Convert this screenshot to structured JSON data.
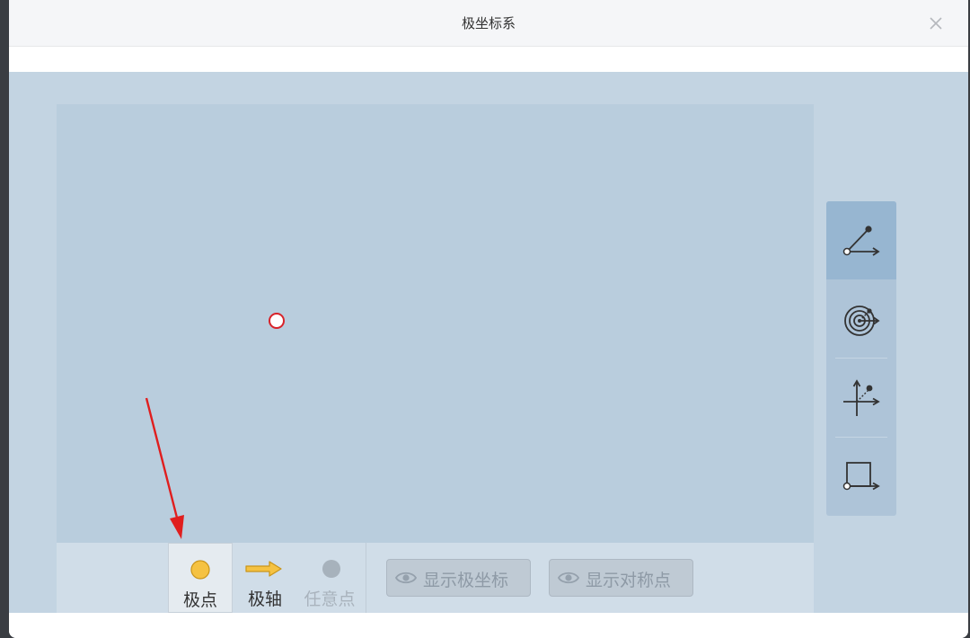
{
  "dialog": {
    "title": "极坐标系",
    "close_icon": "close-icon"
  },
  "toolbar": {
    "tools": [
      {
        "label": "极点",
        "icon": "circle-yellow-icon",
        "active": true,
        "enabled": true
      },
      {
        "label": "极轴",
        "icon": "arrow-right-yellow-icon",
        "active": false,
        "enabled": true
      },
      {
        "label": "任意点",
        "icon": "circle-gray-icon",
        "active": false,
        "enabled": false
      }
    ],
    "show_polar_label": "显示极坐标",
    "show_symmetric_label": "显示对称点"
  },
  "side_panel": {
    "buttons": [
      {
        "icon": "angle-ray-icon",
        "active": true
      },
      {
        "icon": "polar-grid-icon",
        "active": false
      },
      {
        "icon": "cartesian-axes-icon",
        "active": false
      },
      {
        "icon": "rectangle-axis-icon",
        "active": false
      }
    ]
  },
  "colors": {
    "stage_bg": "#c3d4e2",
    "canvas_bg": "#b9cddd",
    "pole_point_stroke": "#d8232a",
    "tool_yellow": "#f5c242",
    "annotation_arrow": "#e01e1e"
  }
}
